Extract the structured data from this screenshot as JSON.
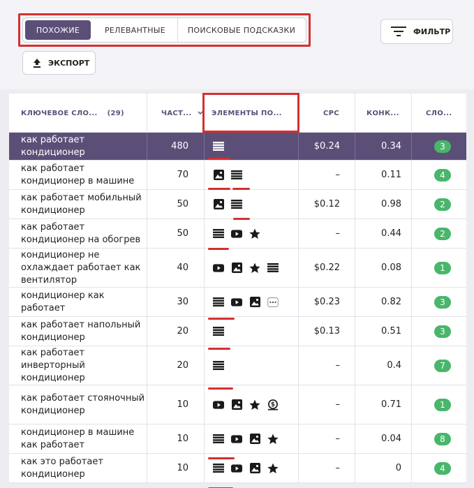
{
  "tabs": [
    "ПОХОЖИЕ",
    "РЕЛЕВАНТНЫЕ",
    "ПОИСКОВЫЕ ПОДСКАЗКИ"
  ],
  "filter_label": "ФИЛЬТР",
  "export_label": "ЭКСПОРТ",
  "columns": {
    "keyword": "КЛЮЧЕВОЕ СЛО...",
    "keyword_count": "(29)",
    "volume": "ЧАСТ...",
    "features": "ЭЛЕМЕНТЫ ПО...",
    "cpc": "CPC",
    "competition": "КОНК...",
    "difficulty": "СЛО..."
  },
  "rows": [
    {
      "keyword": "как работает кондиционер",
      "volume": "480",
      "features": [
        "list-icon"
      ],
      "cpc": "$0.24",
      "competition": "0.34",
      "difficulty": "3"
    },
    {
      "keyword": "как работает кондиционер в машине",
      "volume": "70",
      "features": [
        "image-icon",
        "list-icon"
      ],
      "cpc": "–",
      "competition": "0.11",
      "difficulty": "4"
    },
    {
      "keyword": "как работает мобильный кондиционер",
      "volume": "50",
      "features": [
        "image-icon",
        "list-icon"
      ],
      "cpc": "$0.12",
      "competition": "0.98",
      "difficulty": "2"
    },
    {
      "keyword": "как работает кондиционер на обогрев",
      "volume": "50",
      "features": [
        "list-icon",
        "video-icon",
        "star-icon"
      ],
      "cpc": "–",
      "competition": "0.44",
      "difficulty": "2"
    },
    {
      "keyword": "кондиционер не охлаждает работает как вентилятор",
      "volume": "40",
      "features": [
        "video-icon",
        "image-icon",
        "star-icon",
        "list-icon"
      ],
      "cpc": "$0.22",
      "competition": "0.08",
      "difficulty": "1"
    },
    {
      "keyword": "кондиционер как работает",
      "volume": "30",
      "features": [
        "list-icon",
        "video-icon",
        "image-icon",
        "more-icon"
      ],
      "cpc": "$0.23",
      "competition": "0.82",
      "difficulty": "3"
    },
    {
      "keyword": "как работает напольный кондиционер",
      "volume": "20",
      "features": [
        "list-icon"
      ],
      "cpc": "$0.13",
      "competition": "0.51",
      "difficulty": "3"
    },
    {
      "keyword": "как работает инверторный кондиционер",
      "volume": "20",
      "features": [
        "list-icon"
      ],
      "cpc": "–",
      "competition": "0.4",
      "difficulty": "7"
    },
    {
      "keyword": "как работает стояночный кондиционер",
      "volume": "10",
      "features": [
        "video-icon",
        "image-icon",
        "star-icon",
        "dollar-icon"
      ],
      "cpc": "–",
      "competition": "0.71",
      "difficulty": "1"
    },
    {
      "keyword": "кондиционер в машине как работает",
      "volume": "10",
      "features": [
        "list-icon",
        "video-icon",
        "image-icon",
        "star-icon"
      ],
      "cpc": "–",
      "competition": "0.04",
      "difficulty": "8"
    },
    {
      "keyword": "как это работает кондиционер",
      "volume": "10",
      "features": [
        "list-icon",
        "video-icon",
        "image-icon",
        "star-icon"
      ],
      "cpc": "–",
      "competition": "0",
      "difficulty": "4"
    }
  ],
  "colors": {
    "accent": "#5b4f78",
    "badge": "#49b66b",
    "highlight": "#d62f2f"
  }
}
